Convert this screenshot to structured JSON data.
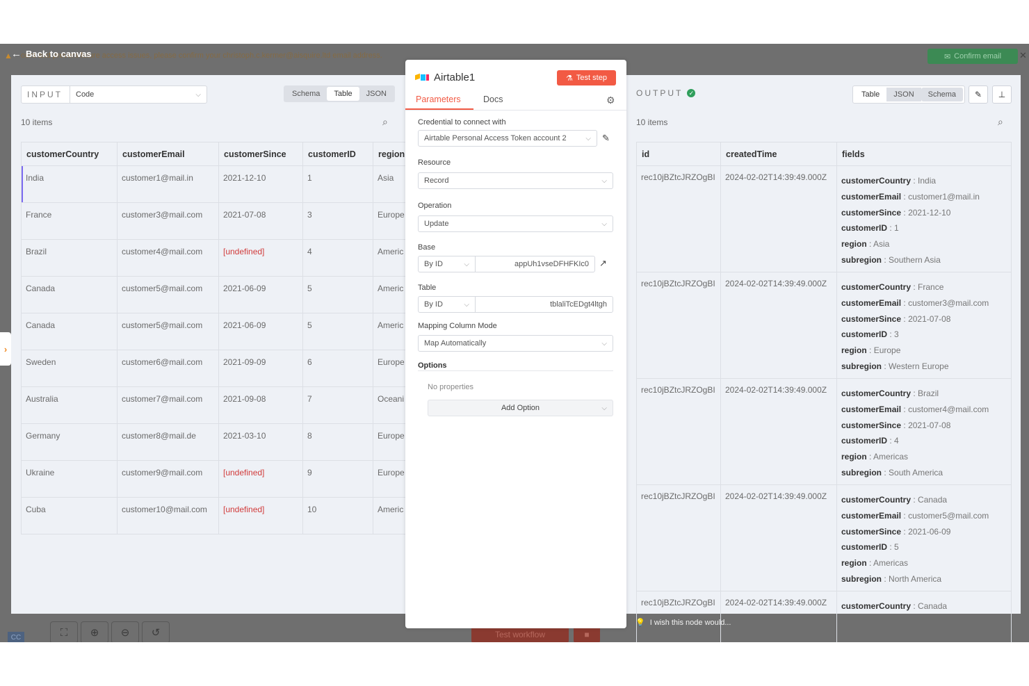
{
  "banner": {
    "text": "ount and prevent future access issues, please confirm your christoph.c.kermer@aisquire.ltd email address.",
    "confirm_label": "Confirm email",
    "close": "✕"
  },
  "back": {
    "label": "Back to canvas"
  },
  "canvas": {
    "test_workflow": "Test workflow",
    "avatar": "CC",
    "wish": "I wish this node would..."
  },
  "input": {
    "caption": "INPUT",
    "source": "Code",
    "views": [
      "Schema",
      "Table",
      "JSON"
    ],
    "active_view": "Table",
    "count": "10 items",
    "columns": [
      "customerCountry",
      "customerEmail",
      "customerSince",
      "customerID",
      "region"
    ],
    "rows": [
      [
        "India",
        "customer1@mail.in",
        "2021-12-10",
        "1",
        "Asia"
      ],
      [
        "France",
        "customer3@mail.com",
        "2021-07-08",
        "3",
        "Europe"
      ],
      [
        "Brazil",
        "customer4@mail.com",
        "[undefined]",
        "4",
        "Americ"
      ],
      [
        "Canada",
        "customer5@mail.com",
        "2021-06-09",
        "5",
        "Americ"
      ],
      [
        "Canada",
        "customer5@mail.com",
        "2021-06-09",
        "5",
        "Americ"
      ],
      [
        "Sweden",
        "customer6@mail.com",
        "2021-09-09",
        "6",
        "Europe"
      ],
      [
        "Australia",
        "customer7@mail.com",
        "2021-09-08",
        "7",
        "Oceani"
      ],
      [
        "Germany",
        "customer8@mail.de",
        "2021-03-10",
        "8",
        "Europe"
      ],
      [
        "Ukraine",
        "customer9@mail.com",
        "[undefined]",
        "9",
        "Europe"
      ],
      [
        "Cuba",
        "customer10@mail.com",
        "[undefined]",
        "10",
        "Americ"
      ]
    ]
  },
  "node": {
    "title": "Airtable1",
    "test_step": "Test step",
    "tabs": [
      "Parameters",
      "Docs"
    ],
    "credential_label": "Credential to connect with",
    "credential_value": "Airtable Personal Access Token account 2",
    "resource_label": "Resource",
    "resource_value": "Record",
    "operation_label": "Operation",
    "operation_value": "Update",
    "base_label": "Base",
    "base_mode": "By ID",
    "base_value": "appUh1vseDFHFKIc0",
    "table_label": "Table",
    "table_mode": "By ID",
    "table_value": "tblaliTcEDgt4ltgh",
    "mapping_label": "Mapping Column Mode",
    "mapping_value": "Map Automatically",
    "options_label": "Options",
    "no_props": "No properties",
    "add_option": "Add Option"
  },
  "output": {
    "caption": "OUTPUT",
    "views": [
      "Table",
      "JSON",
      "Schema"
    ],
    "active_view": "Table",
    "count": "10 items",
    "columns": [
      "id",
      "createdTime",
      "fields"
    ],
    "rows": [
      {
        "id": "rec10jBZtcJRZOgBI",
        "created": "2024-02-02T14:39:49.000Z",
        "fields": [
          [
            "customerCountry",
            "India"
          ],
          [
            "customerEmail",
            "customer1@mail.in"
          ],
          [
            "customerSince",
            "2021-12-10"
          ],
          [
            "customerID",
            "1"
          ],
          [
            "region",
            "Asia"
          ],
          [
            "subregion",
            "Southern Asia"
          ]
        ]
      },
      {
        "id": "rec10jBZtcJRZOgBI",
        "created": "2024-02-02T14:39:49.000Z",
        "fields": [
          [
            "customerCountry",
            "France"
          ],
          [
            "customerEmail",
            "customer3@mail.com"
          ],
          [
            "customerSince",
            "2021-07-08"
          ],
          [
            "customerID",
            "3"
          ],
          [
            "region",
            "Europe"
          ],
          [
            "subregion",
            "Western Europe"
          ]
        ]
      },
      {
        "id": "rec10jBZtcJRZOgBI",
        "created": "2024-02-02T14:39:49.000Z",
        "fields": [
          [
            "customerCountry",
            "Brazil"
          ],
          [
            "customerEmail",
            "customer4@mail.com"
          ],
          [
            "customerSince",
            "2021-07-08"
          ],
          [
            "customerID",
            "4"
          ],
          [
            "region",
            "Americas"
          ],
          [
            "subregion",
            "South America"
          ]
        ]
      },
      {
        "id": "rec10jBZtcJRZOgBI",
        "created": "2024-02-02T14:39:49.000Z",
        "fields": [
          [
            "customerCountry",
            "Canada"
          ],
          [
            "customerEmail",
            "customer5@mail.com"
          ],
          [
            "customerSince",
            "2021-06-09"
          ],
          [
            "customerID",
            "5"
          ],
          [
            "region",
            "Americas"
          ],
          [
            "subregion",
            "North America"
          ]
        ]
      },
      {
        "id": "rec10jBZtcJRZOgBI",
        "created": "2024-02-02T14:39:49.000Z",
        "fields": [
          [
            "customerCountry",
            "Canada"
          ]
        ]
      }
    ]
  },
  "colors": {
    "accent": "#f25a44",
    "success": "#2f9e5b",
    "undefined": "#d13b3b"
  },
  "icons": [
    "arrow-left-icon",
    "warning-icon",
    "envelope-icon",
    "flask-icon",
    "airtable-logo-icon",
    "gear-icon",
    "pencil-icon",
    "external-link-icon",
    "search-icon",
    "pin-icon",
    "check-circle-icon",
    "lightbulb-icon",
    "fit-view-icon",
    "zoom-in-icon",
    "zoom-out-icon",
    "undo-icon",
    "trash-icon",
    "chevron-down-icon"
  ]
}
